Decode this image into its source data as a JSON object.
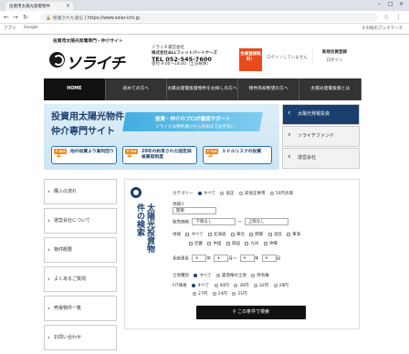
{
  "browser": {
    "tab_title": "投資用太陽光発電物件",
    "url_secure": "保護された通信",
    "url": "https://www.solar-ichi.jp",
    "bookmarks": [
      "アプリ",
      "Google"
    ],
    "bookmark_right": "その他のブックマーク"
  },
  "header": {
    "tagline": "投資用太陽光発電専門・仲介サイト",
    "logo": "ソライチ",
    "company_name": "ソライチ運営会社",
    "company_full": "株式会社ALLフィットパートナーズ",
    "tel": "TEL 052-545-7600",
    "hours": "受付 9:00〜18:00（土日祝休）",
    "cta": "会員登録無料！",
    "login_msg": "ログインしていません",
    "register": "新規会員登録",
    "login": "ログイン"
  },
  "gnav": [
    {
      "label": "HOME",
      "active": true
    },
    {
      "label": "初めての方へ"
    },
    {
      "label": "太陽光発電投資物件をお探しの方へ"
    },
    {
      "label": "物件売却希望の方へ"
    },
    {
      "label": "太陽光発電投資とは"
    }
  ],
  "hero": {
    "title1": "投資用太陽光物件",
    "title2": "仲介専門サイト",
    "right1": "投資・仲介のプロが徹底サポート",
    "right2": "ソライチは物件選びから売却までお手伝い",
    "points": [
      {
        "tag": "Point",
        "num": "1",
        "text": "他の投資より高利回り"
      },
      {
        "tag": "Point",
        "num": "2",
        "text": "20年の約束された固定価格買取制度"
      },
      {
        "tag": "Point",
        "num": "3",
        "text": "ミドルリスクの投資"
      }
    ]
  },
  "side_tabs": [
    "太陽光発電投資",
    "ソライチファンド",
    "運営会社"
  ],
  "leftnav": [
    "購入の流れ",
    "運営会社について",
    "物件概要",
    "よくあるご質問",
    "売電物件一覧",
    "お問い合わせ"
  ],
  "search": {
    "title": "太陽光投資物件の検索",
    "category_label": "カテゴリー",
    "category_opts": [
      "すべて",
      "低圧",
      "高低圧併用",
      "50円太陽"
    ],
    "area_label": "地域①",
    "area_val": "関東",
    "price_label": "販売価格",
    "price_min": "下限なし",
    "price_sep": "〜",
    "price_max": "上限なし",
    "region_label": "地域",
    "regions": [
      "すべて",
      "北海道",
      "東北",
      "関東",
      "北陸",
      "東海",
      "近畿",
      "中国",
      "四国",
      "九州",
      "沖縄"
    ],
    "date_label": "系統連系",
    "date_parts": [
      "年",
      "月〜",
      "年",
      "月"
    ],
    "type_label": "土地種別",
    "type_opts": [
      "すべて",
      "賃借権付土地",
      "所有権"
    ],
    "fit_label": "FIT価格",
    "fit_opts": [
      "すべて",
      "40円",
      "36円",
      "32円",
      "29円",
      "27円",
      "24円",
      "21円"
    ],
    "button": "この条件で検索"
  }
}
